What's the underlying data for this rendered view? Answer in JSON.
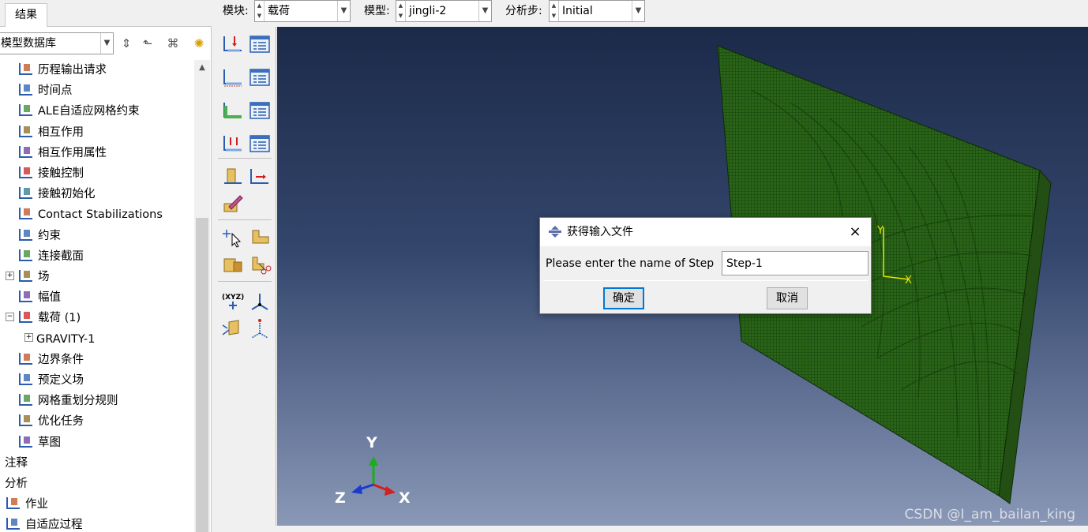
{
  "left_panel": {
    "tab": "结果",
    "db_select": "模型数据库",
    "tree": [
      {
        "label": "历程输出请求",
        "icon": "history-output-icon",
        "indent": 1
      },
      {
        "label": "时间点",
        "icon": "time-points-icon",
        "indent": 1
      },
      {
        "label": "ALE自适应网格约束",
        "icon": "ale-constraint-icon",
        "indent": 1
      },
      {
        "label": "相互作用",
        "icon": "interaction-icon",
        "indent": 1
      },
      {
        "label": "相互作用属性",
        "icon": "interaction-property-icon",
        "indent": 1
      },
      {
        "label": "接触控制",
        "icon": "contact-control-icon",
        "indent": 1
      },
      {
        "label": "接触初始化",
        "icon": "contact-init-icon",
        "indent": 1
      },
      {
        "label": "Contact Stabilizations",
        "icon": "contact-stabilization-icon",
        "indent": 1
      },
      {
        "label": "约束",
        "icon": "constraint-icon",
        "indent": 1
      },
      {
        "label": "连接截面",
        "icon": "connector-section-icon",
        "indent": 1
      },
      {
        "label": "场",
        "icon": "field-icon",
        "indent": 1,
        "expander": "+"
      },
      {
        "label": "幅值",
        "icon": "amplitude-icon",
        "indent": 1
      },
      {
        "label": "载荷 (1)",
        "icon": "load-icon",
        "indent": 1,
        "expander": "-"
      },
      {
        "label": "GRAVITY-1",
        "icon": "",
        "indent": 2,
        "expander": "+"
      },
      {
        "label": "边界条件",
        "icon": "boundary-condition-icon",
        "indent": 1
      },
      {
        "label": "预定义场",
        "icon": "predefined-field-icon",
        "indent": 1
      },
      {
        "label": "网格重划分规则",
        "icon": "remesh-rule-icon",
        "indent": 1
      },
      {
        "label": "优化任务",
        "icon": "optimization-icon",
        "indent": 1
      },
      {
        "label": "草图",
        "icon": "sketch-icon",
        "indent": 1
      },
      {
        "label": "注释",
        "icon": "",
        "indent": 0
      },
      {
        "label": "分析",
        "icon": "",
        "indent": 0
      },
      {
        "label": "作业",
        "icon": "job-icon",
        "indent": 0
      },
      {
        "label": "自适应过程",
        "icon": "adaptivity-icon",
        "indent": 0
      }
    ]
  },
  "top_bar": {
    "module_label": "模块:",
    "module_value": "载荷",
    "model_label": "模型:",
    "model_value": "jingli-2",
    "step_label": "分析步:",
    "step_value": "Initial"
  },
  "viewport": {
    "triad_y": "Y",
    "triad_x": "X",
    "triad_z": "Z",
    "local_y": "Y",
    "local_x": "X",
    "watermark": "CSDN @I_am_bailan_king"
  },
  "dialog": {
    "title": "获得输入文件",
    "close": "×",
    "prompt": "Please enter the name of Step",
    "input_value": "Step-1",
    "ok": "确定",
    "cancel": "取消"
  },
  "colors": {
    "mesh_green": "#2a6418",
    "mesh_line": "#123a0a",
    "viewport_top": "#1b2a49",
    "viewport_bottom": "#8a98b6",
    "ok_border": "#0078d7"
  }
}
